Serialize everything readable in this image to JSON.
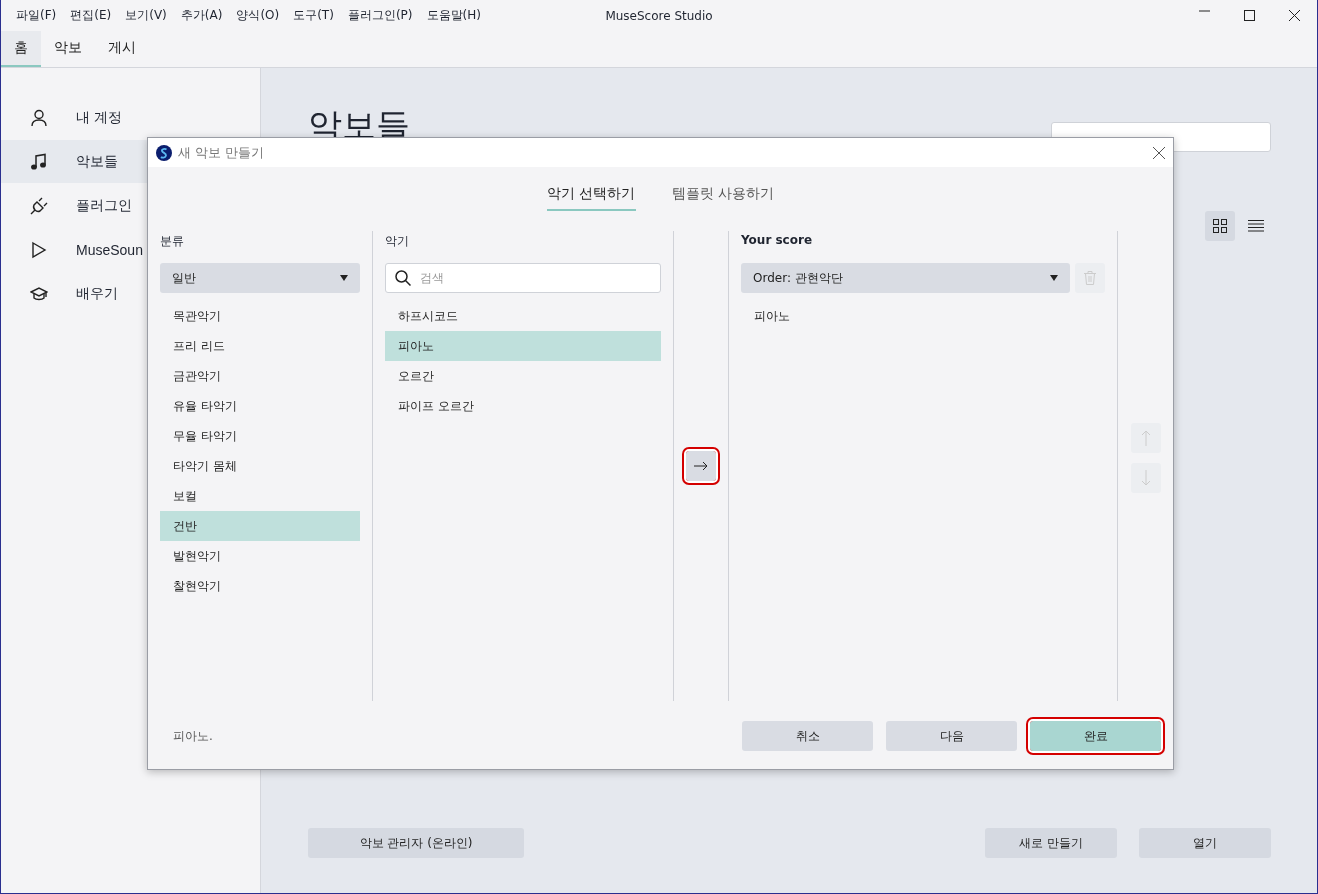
{
  "menu": [
    "파일(F)",
    "편집(E)",
    "보기(V)",
    "추가(A)",
    "양식(O)",
    "도구(T)",
    "플러그인(P)",
    "도움말(H)"
  ],
  "app_title": "MuseScore Studio",
  "tabs": [
    {
      "label": "홈",
      "selected": true
    },
    {
      "label": "악보",
      "selected": false
    },
    {
      "label": "게시",
      "selected": false
    }
  ],
  "sidebar": {
    "items": [
      {
        "label": "내 계정",
        "selected": false
      },
      {
        "label": "악보들",
        "selected": true
      },
      {
        "label": "플러그인",
        "selected": false
      },
      {
        "label": "MuseSoun",
        "selected": false
      },
      {
        "label": "배우기",
        "selected": false
      }
    ]
  },
  "page": {
    "heading": "악보들",
    "views": [
      {
        "kind": "grid",
        "selected": true
      },
      {
        "kind": "list",
        "selected": false
      }
    ],
    "buttons": [
      {
        "label": "악보 관리자 (온라인)",
        "kind": "left"
      },
      {
        "label": "새로 만들기",
        "kind": "right"
      },
      {
        "label": "열기",
        "kind": "right"
      }
    ]
  },
  "dialog": {
    "title": "새 악보 만들기",
    "tabs": [
      {
        "label": "악기 선택하기",
        "selected": true
      },
      {
        "label": "템플릿 사용하기",
        "selected": false
      }
    ],
    "category_heading": "분류",
    "category_dropdown": "일반",
    "categories": [
      {
        "label": "목관악기",
        "selected": false
      },
      {
        "label": "프리 리드",
        "selected": false
      },
      {
        "label": "금관악기",
        "selected": false
      },
      {
        "label": "유율 타악기",
        "selected": false
      },
      {
        "label": "무율 타악기",
        "selected": false
      },
      {
        "label": "타악기 몸체",
        "selected": false
      },
      {
        "label": "보컬",
        "selected": false
      },
      {
        "label": "건반",
        "selected": true
      },
      {
        "label": "발현악기",
        "selected": false
      },
      {
        "label": "찰현악기",
        "selected": false
      }
    ],
    "instrument_heading": "악기",
    "instrument_search_placeholder": "검색",
    "instruments": [
      {
        "label": "하프시코드",
        "selected": false
      },
      {
        "label": "피아노",
        "selected": true
      },
      {
        "label": "오르간",
        "selected": false
      },
      {
        "label": "파이프 오르간",
        "selected": false
      }
    ],
    "add_button": {
      "highlighted": true
    },
    "score_heading": "Your score",
    "order_dropdown": "Order: 관현악단",
    "delete_disabled": true,
    "score_items": [
      {
        "label": "피아노"
      }
    ],
    "move_up_disabled": true,
    "move_down_disabled": true,
    "status": "피아노.",
    "buttons": [
      {
        "label": "취소",
        "kind": "secondary",
        "highlighted": false
      },
      {
        "label": "다음",
        "kind": "secondary",
        "highlighted": false
      },
      {
        "label": "완료",
        "kind": "primary",
        "highlighted": true
      }
    ]
  }
}
